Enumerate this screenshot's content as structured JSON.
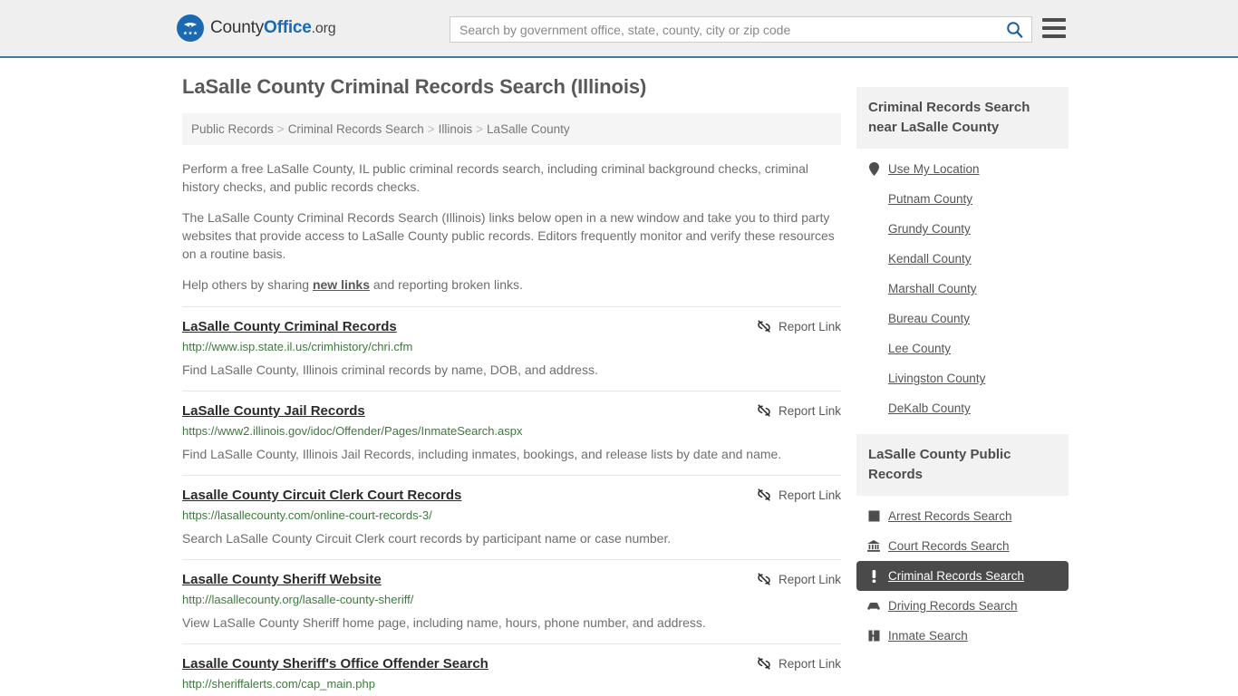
{
  "header": {
    "logo_primary": "County",
    "logo_accent": "Office",
    "logo_suffix": ".org",
    "logo_icon": "eagle-shield-icon",
    "search_placeholder": "Search by government office, state, county, city or zip code",
    "search_value": "",
    "search_icon": "search-icon",
    "menu_icon": "hamburger-menu-icon",
    "accent_color": "#1b69b3",
    "border_color": "#3a7ca5"
  },
  "main": {
    "title": "LaSalle County Criminal Records Search (Illinois)",
    "breadcrumb": [
      "Public Records",
      "Criminal Records Search",
      "Illinois",
      "LaSalle County"
    ],
    "breadcrumb_separator": ">",
    "intro_1": "Perform a free LaSalle County, IL public criminal records search, including criminal background checks, criminal history checks, and public records checks.",
    "intro_2": "The LaSalle County Criminal Records Search (Illinois) links below open in a new window and take you to third party websites that provide access to LaSalle County public records. Editors frequently monitor and verify these resources on a routine basis.",
    "help_prefix": "Help others by sharing ",
    "help_link": "new links",
    "help_suffix": " and reporting broken links.",
    "report_label": "Report Link",
    "report_icon": "broken-link-icon",
    "results": [
      {
        "title": "LaSalle County Criminal Records",
        "url": "http://www.isp.state.il.us/crimhistory/chri.cfm",
        "description": "Find LaSalle County, Illinois criminal records by name, DOB, and address."
      },
      {
        "title": "LaSalle County Jail Records",
        "url": "https://www2.illinois.gov/idoc/Offender/Pages/InmateSearch.aspx",
        "description": "Find LaSalle County, Illinois Jail Records, including inmates, bookings, and release lists by date and name."
      },
      {
        "title": "Lasalle County Circuit Clerk Court Records",
        "url": "https://lasallecounty.com/online-court-records-3/",
        "description": "Search LaSalle County Circuit Clerk court records by participant name or case number."
      },
      {
        "title": "Lasalle County Sheriff Website",
        "url": "http://lasallecounty.org/lasalle-county-sheriff/",
        "description": "View LaSalle County Sheriff home page, including name, hours, phone number, and address."
      },
      {
        "title": "Lasalle County Sheriff's Office Offender Search",
        "url": "http://sheriffalerts.com/cap_main.php",
        "description": ""
      }
    ]
  },
  "sidebar": {
    "nearby": {
      "heading": "Criminal Records Search near LaSalle County",
      "items": [
        {
          "label": "Use My Location",
          "icon": "map-pin-icon",
          "active": false
        },
        {
          "label": "Putnam County",
          "icon": "",
          "active": false
        },
        {
          "label": "Grundy County",
          "icon": "",
          "active": false
        },
        {
          "label": "Kendall County",
          "icon": "",
          "active": false
        },
        {
          "label": "Marshall County",
          "icon": "",
          "active": false
        },
        {
          "label": "Bureau County",
          "icon": "",
          "active": false
        },
        {
          "label": "Lee County",
          "icon": "",
          "active": false
        },
        {
          "label": "Livingston County",
          "icon": "",
          "active": false
        },
        {
          "label": "DeKalb County",
          "icon": "",
          "active": false
        }
      ]
    },
    "public_records": {
      "heading": "LaSalle County Public Records",
      "items": [
        {
          "label": "Arrest Records Search",
          "icon": "handcuffs-icon",
          "active": false
        },
        {
          "label": "Court Records Search",
          "icon": "courthouse-icon",
          "active": false
        },
        {
          "label": "Criminal Records Search",
          "icon": "exclamation-icon",
          "active": true
        },
        {
          "label": "Driving Records Search",
          "icon": "car-icon",
          "active": false
        },
        {
          "label": "Inmate Search",
          "icon": "jail-icon",
          "active": false
        }
      ],
      "active_bg": "#4a4a4a"
    }
  }
}
